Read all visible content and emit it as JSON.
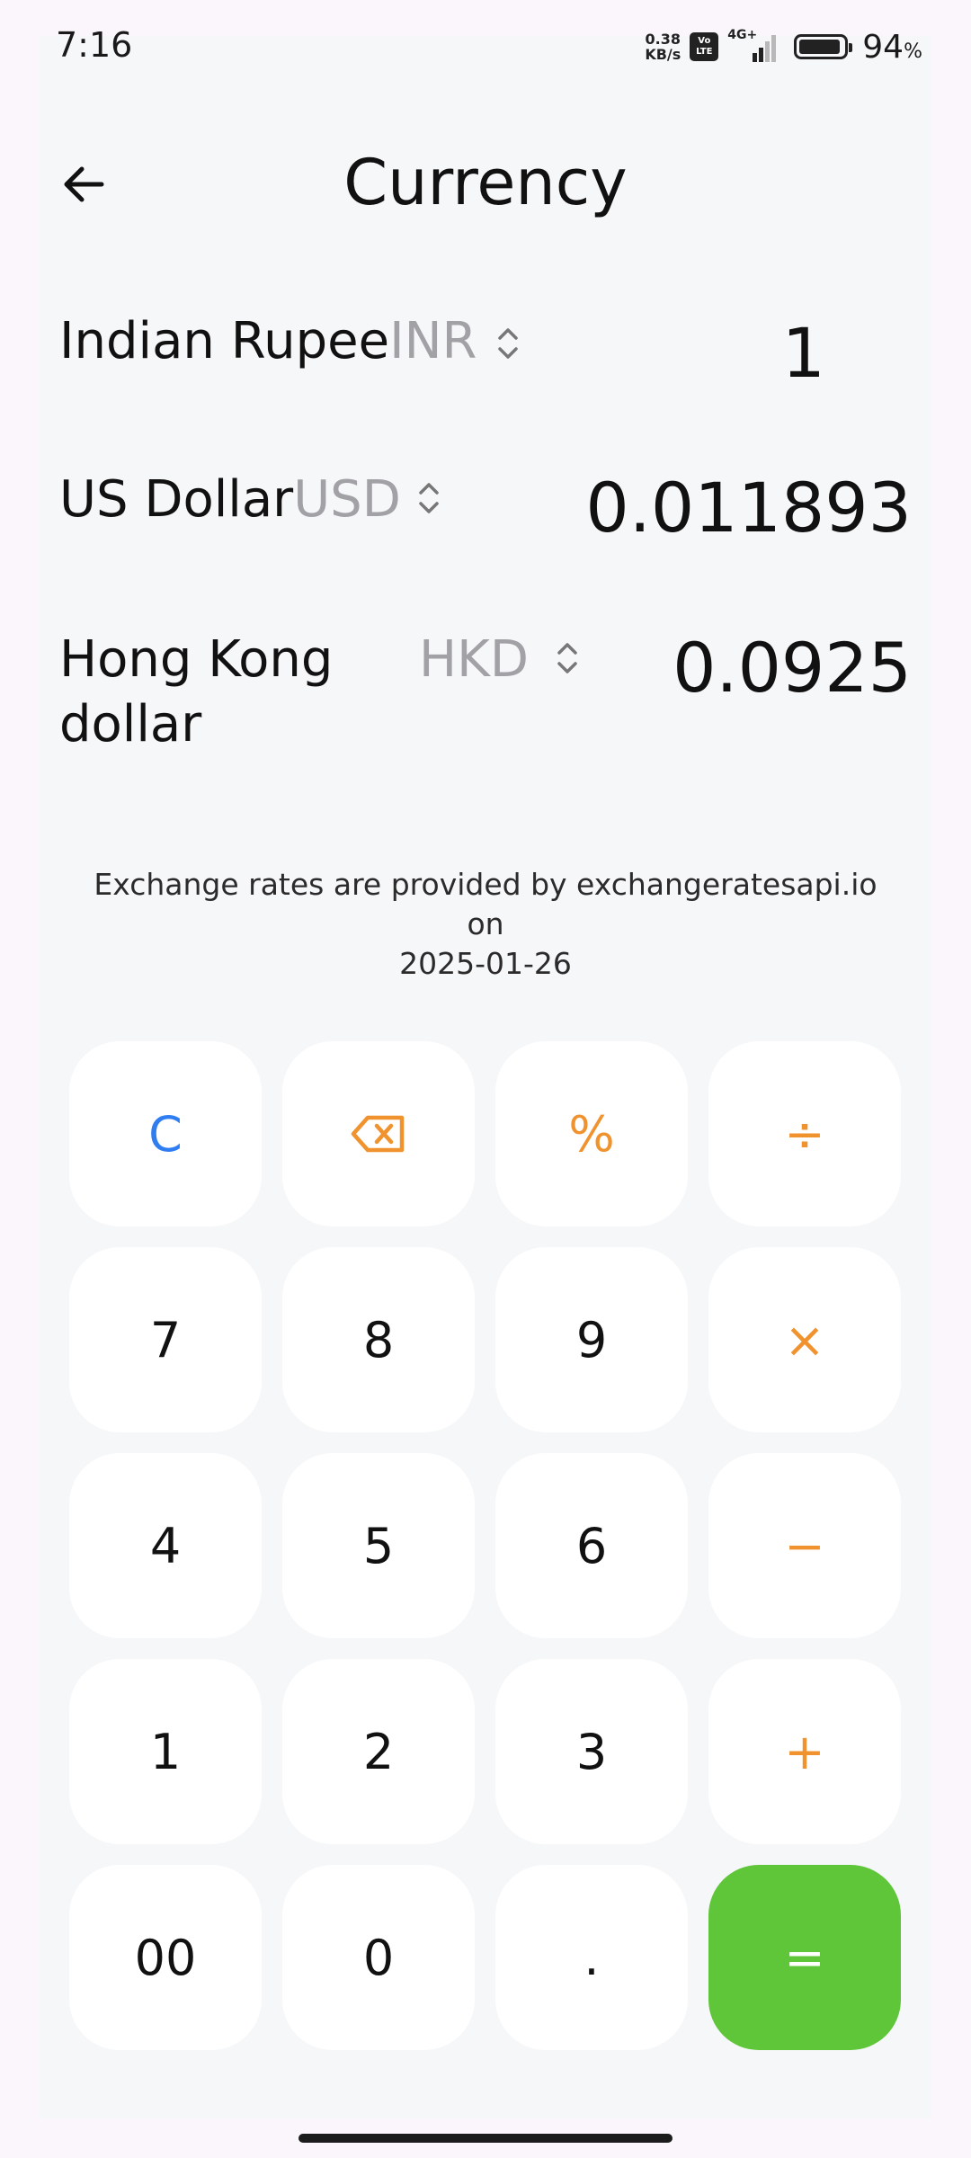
{
  "status_bar": {
    "time": "7:16",
    "net_speed_value": "0.38",
    "net_speed_unit": "KB/s",
    "volte_top": "Vo",
    "volte_bottom": "LTE",
    "network": "4G+",
    "battery_level": 94,
    "battery_value": "94",
    "battery_unit": "%"
  },
  "header": {
    "title": "Currency",
    "back_icon": "arrow-left-icon"
  },
  "currencies": [
    {
      "name": "Indian Rupee",
      "code": "INR",
      "value": "1"
    },
    {
      "name": "US Dollar",
      "code": "USD",
      "value": "0.011893"
    },
    {
      "name_line1": "Hong Kong",
      "name_line2": "dollar",
      "code": "HKD",
      "value": "0.0925"
    }
  ],
  "rate_note": {
    "line1": "Exchange rates are provided by exchangeratesapi.io on",
    "line2": "2025-01-26"
  },
  "keypad": {
    "keys": [
      {
        "label": "C",
        "kind": "clear",
        "name": "clear-button"
      },
      {
        "label": "⌫",
        "kind": "op",
        "name": "backspace-button",
        "icon": "backspace-icon"
      },
      {
        "label": "%",
        "kind": "op",
        "name": "percent-button"
      },
      {
        "label": "÷",
        "kind": "op",
        "name": "divide-button"
      },
      {
        "label": "7",
        "kind": "digit",
        "name": "key-7"
      },
      {
        "label": "8",
        "kind": "digit",
        "name": "key-8"
      },
      {
        "label": "9",
        "kind": "digit",
        "name": "key-9"
      },
      {
        "label": "×",
        "kind": "op",
        "name": "multiply-button"
      },
      {
        "label": "4",
        "kind": "digit",
        "name": "key-4"
      },
      {
        "label": "5",
        "kind": "digit",
        "name": "key-5"
      },
      {
        "label": "6",
        "kind": "digit",
        "name": "key-6"
      },
      {
        "label": "−",
        "kind": "op",
        "name": "minus-button"
      },
      {
        "label": "1",
        "kind": "digit",
        "name": "key-1"
      },
      {
        "label": "2",
        "kind": "digit",
        "name": "key-2"
      },
      {
        "label": "3",
        "kind": "digit",
        "name": "key-3"
      },
      {
        "label": "+",
        "kind": "op",
        "name": "plus-button"
      },
      {
        "label": "00",
        "kind": "digit",
        "name": "key-00"
      },
      {
        "label": "0",
        "kind": "digit",
        "name": "key-0"
      },
      {
        "label": ".",
        "kind": "digit",
        "name": "decimal-button"
      },
      {
        "label": "=",
        "kind": "equals",
        "name": "equals-button"
      }
    ]
  },
  "colors": {
    "operator": "#f0922d",
    "clear": "#2f7df0",
    "equals_bg": "#5fc539",
    "code_gray": "#a2a2a6"
  }
}
